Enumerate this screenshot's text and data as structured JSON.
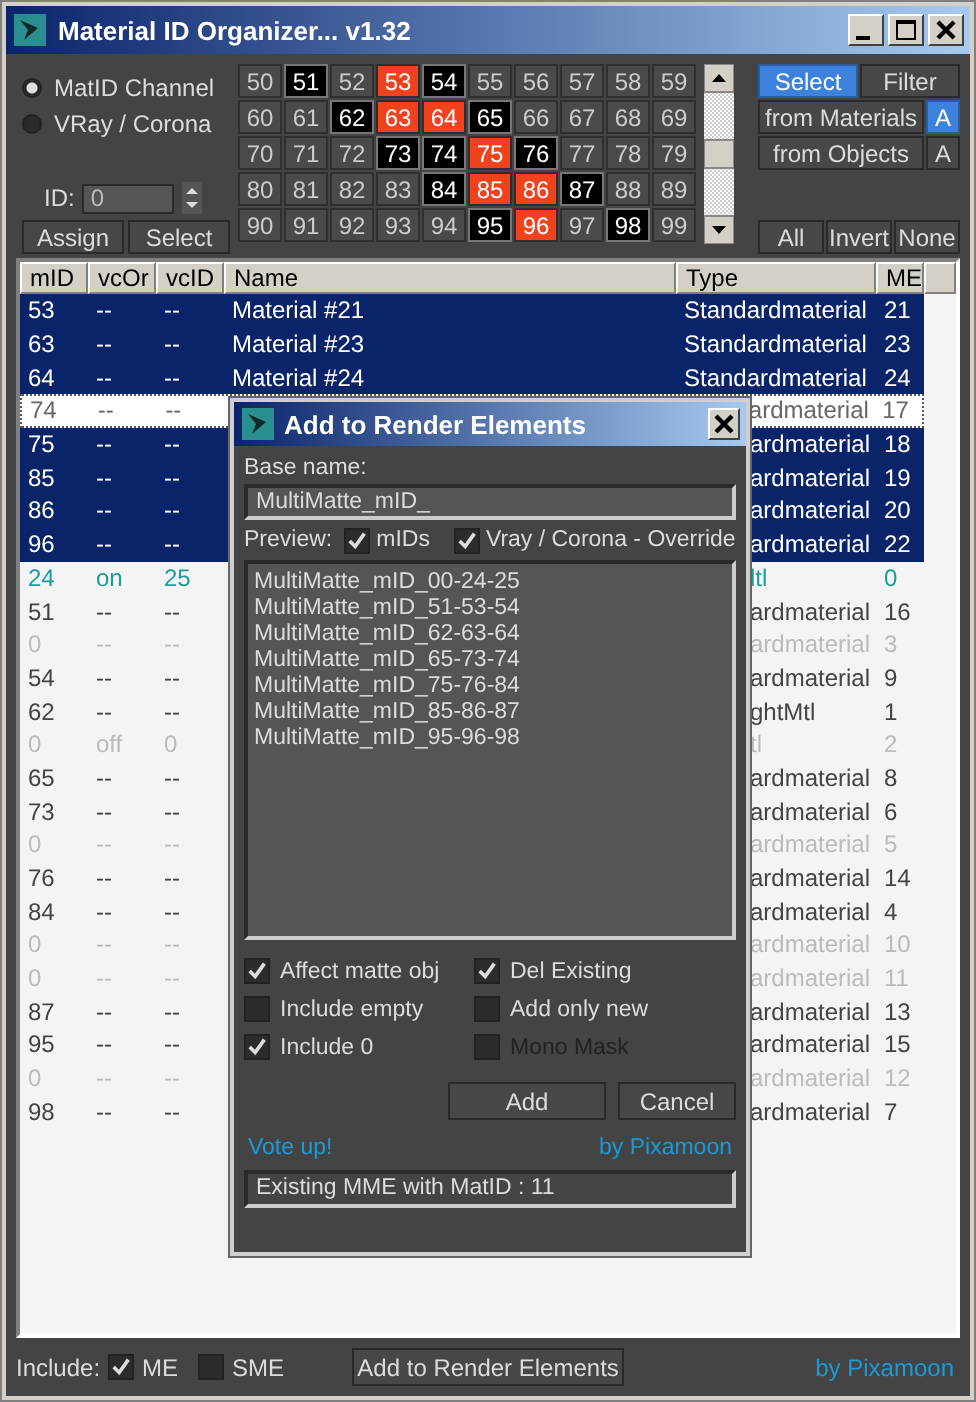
{
  "window": {
    "title": "Material ID Organizer... v1.32"
  },
  "channel_options": [
    {
      "label": "MatID Channel",
      "selected": true
    },
    {
      "label": "VRay / Corona",
      "selected": false
    }
  ],
  "id_field": {
    "label": "ID:",
    "value": "0"
  },
  "id_buttons": [
    "Assign",
    "Select"
  ],
  "id_grid": [
    {
      "label": "50",
      "used": false,
      "selected": false
    },
    {
      "label": "51",
      "used": true,
      "selected": false
    },
    {
      "label": "52",
      "used": false,
      "selected": false
    },
    {
      "label": "53",
      "used": false,
      "selected": true
    },
    {
      "label": "54",
      "used": true,
      "selected": false
    },
    {
      "label": "55",
      "used": false,
      "selected": false
    },
    {
      "label": "56",
      "used": false,
      "selected": false
    },
    {
      "label": "57",
      "used": false,
      "selected": false
    },
    {
      "label": "58",
      "used": false,
      "selected": false
    },
    {
      "label": "59",
      "used": false,
      "selected": false
    },
    {
      "label": "60",
      "used": false,
      "selected": false
    },
    {
      "label": "61",
      "used": false,
      "selected": false
    },
    {
      "label": "62",
      "used": true,
      "selected": false
    },
    {
      "label": "63",
      "used": false,
      "selected": true
    },
    {
      "label": "64",
      "used": false,
      "selected": true
    },
    {
      "label": "65",
      "used": true,
      "selected": false
    },
    {
      "label": "66",
      "used": false,
      "selected": false
    },
    {
      "label": "67",
      "used": false,
      "selected": false
    },
    {
      "label": "68",
      "used": false,
      "selected": false
    },
    {
      "label": "69",
      "used": false,
      "selected": false
    },
    {
      "label": "70",
      "used": false,
      "selected": false
    },
    {
      "label": "71",
      "used": false,
      "selected": false
    },
    {
      "label": "72",
      "used": false,
      "selected": false
    },
    {
      "label": "73",
      "used": true,
      "selected": false
    },
    {
      "label": "74",
      "used": true,
      "selected": false
    },
    {
      "label": "75",
      "used": false,
      "selected": true
    },
    {
      "label": "76",
      "used": true,
      "selected": false
    },
    {
      "label": "77",
      "used": false,
      "selected": false
    },
    {
      "label": "78",
      "used": false,
      "selected": false
    },
    {
      "label": "79",
      "used": false,
      "selected": false
    },
    {
      "label": "80",
      "used": false,
      "selected": false
    },
    {
      "label": "81",
      "used": false,
      "selected": false
    },
    {
      "label": "82",
      "used": false,
      "selected": false
    },
    {
      "label": "83",
      "used": false,
      "selected": false
    },
    {
      "label": "84",
      "used": true,
      "selected": false
    },
    {
      "label": "85",
      "used": false,
      "selected": true
    },
    {
      "label": "86",
      "used": false,
      "selected": true
    },
    {
      "label": "87",
      "used": true,
      "selected": false
    },
    {
      "label": "88",
      "used": false,
      "selected": false
    },
    {
      "label": "89",
      "used": false,
      "selected": false
    },
    {
      "label": "90",
      "used": false,
      "selected": false
    },
    {
      "label": "91",
      "used": false,
      "selected": false
    },
    {
      "label": "92",
      "used": false,
      "selected": false
    },
    {
      "label": "93",
      "used": false,
      "selected": false
    },
    {
      "label": "94",
      "used": false,
      "selected": false
    },
    {
      "label": "95",
      "used": true,
      "selected": false
    },
    {
      "label": "96",
      "used": false,
      "selected": true
    },
    {
      "label": "97",
      "used": false,
      "selected": false
    },
    {
      "label": "98",
      "used": true,
      "selected": false
    },
    {
      "label": "99",
      "used": false,
      "selected": false
    }
  ],
  "mode_tabs": [
    {
      "label": "Select",
      "selected": true
    },
    {
      "label": "Filter",
      "selected": false
    }
  ],
  "source_buttons": [
    {
      "label": "from Materials",
      "toggle": "A",
      "toggle_on": true
    },
    {
      "label": "from Objects",
      "toggle": "A",
      "toggle_on": false
    }
  ],
  "selection_buttons": [
    "All",
    "Invert",
    "None"
  ],
  "table": {
    "columns": [
      "mID",
      "vcOr",
      "vcID",
      "Name",
      "Type",
      "ME"
    ],
    "rows": [
      {
        "mID": "53",
        "vcOr": "--",
        "vcID": "--",
        "name": "Material #21",
        "type": "Standardmaterial",
        "me": "21",
        "kind": "material",
        "selected": true,
        "focused": false,
        "covered": false
      },
      {
        "mID": "63",
        "vcOr": "--",
        "vcID": "--",
        "name": "Material #23",
        "type": "Standardmaterial",
        "me": "23",
        "kind": "material",
        "selected": true,
        "focused": false,
        "covered": false
      },
      {
        "mID": "64",
        "vcOr": "--",
        "vcID": "--",
        "name": "Material #24",
        "type": "Standardmaterial",
        "me": "24",
        "kind": "material",
        "selected": true,
        "focused": false,
        "covered": false
      },
      {
        "mID": "74",
        "vcOr": "--",
        "vcID": "--",
        "type": "ardmaterial",
        "me": "17",
        "kind": "material",
        "selected": false,
        "focused": true,
        "covered": true
      },
      {
        "mID": "75",
        "vcOr": "--",
        "vcID": "--",
        "type": "ardmaterial",
        "me": "18",
        "kind": "material",
        "selected": true,
        "focused": false,
        "covered": true
      },
      {
        "mID": "85",
        "vcOr": "--",
        "vcID": "--",
        "type": "ardmaterial",
        "me": "19",
        "kind": "material",
        "selected": true,
        "focused": false,
        "covered": true
      },
      {
        "mID": "86",
        "vcOr": "--",
        "vcID": "--",
        "type": "ardmaterial",
        "me": "20",
        "kind": "material",
        "selected": true,
        "focused": false,
        "covered": true
      },
      {
        "mID": "96",
        "vcOr": "--",
        "vcID": "--",
        "type": "ardmaterial",
        "me": "22",
        "kind": "material",
        "selected": true,
        "focused": false,
        "covered": true
      },
      {
        "mID": "24",
        "vcOr": "on",
        "vcID": "25",
        "type": "ltl",
        "me": "0",
        "kind": "override",
        "selected": false,
        "focused": false,
        "covered": true
      },
      {
        "mID": "51",
        "vcOr": "--",
        "vcID": "--",
        "type": "ardmaterial",
        "me": "16",
        "kind": "material",
        "selected": false,
        "focused": false,
        "covered": true
      },
      {
        "mID": "0",
        "vcOr": "--",
        "vcID": "--",
        "type": "ardmaterial",
        "me": "3",
        "kind": "empty",
        "selected": false,
        "focused": false,
        "covered": true
      },
      {
        "mID": "54",
        "vcOr": "--",
        "vcID": "--",
        "type": "ardmaterial",
        "me": "9",
        "kind": "material",
        "selected": false,
        "focused": false,
        "covered": true
      },
      {
        "mID": "62",
        "vcOr": "--",
        "vcID": "--",
        "type": "ghtMtl",
        "me": "1",
        "kind": "material",
        "selected": false,
        "focused": false,
        "covered": true
      },
      {
        "mID": "0",
        "vcOr": "off",
        "vcID": "0",
        "type": "tl",
        "me": "2",
        "kind": "empty",
        "selected": false,
        "focused": false,
        "covered": true
      },
      {
        "mID": "65",
        "vcOr": "--",
        "vcID": "--",
        "type": "ardmaterial",
        "me": "8",
        "kind": "material",
        "selected": false,
        "focused": false,
        "covered": true
      },
      {
        "mID": "73",
        "vcOr": "--",
        "vcID": "--",
        "type": "ardmaterial",
        "me": "6",
        "kind": "material",
        "selected": false,
        "focused": false,
        "covered": true
      },
      {
        "mID": "0",
        "vcOr": "--",
        "vcID": "--",
        "type": "ardmaterial",
        "me": "5",
        "kind": "empty",
        "selected": false,
        "focused": false,
        "covered": true
      },
      {
        "mID": "76",
        "vcOr": "--",
        "vcID": "--",
        "type": "ardmaterial",
        "me": "14",
        "kind": "material",
        "selected": false,
        "focused": false,
        "covered": true
      },
      {
        "mID": "84",
        "vcOr": "--",
        "vcID": "--",
        "type": "ardmaterial",
        "me": "4",
        "kind": "material",
        "selected": false,
        "focused": false,
        "covered": true
      },
      {
        "mID": "0",
        "vcOr": "--",
        "vcID": "--",
        "type": "ardmaterial",
        "me": "10",
        "kind": "empty",
        "selected": false,
        "focused": false,
        "covered": true
      },
      {
        "mID": "0",
        "vcOr": "--",
        "vcID": "--",
        "type": "ardmaterial",
        "me": "11",
        "kind": "empty",
        "selected": false,
        "focused": false,
        "covered": true
      },
      {
        "mID": "87",
        "vcOr": "--",
        "vcID": "--",
        "type": "ardmaterial",
        "me": "13",
        "kind": "material",
        "selected": false,
        "focused": false,
        "covered": true
      },
      {
        "mID": "95",
        "vcOr": "--",
        "vcID": "--",
        "type": "ardmaterial",
        "me": "15",
        "kind": "material",
        "selected": false,
        "focused": false,
        "covered": true
      },
      {
        "mID": "0",
        "vcOr": "--",
        "vcID": "--",
        "type": "ardmaterial",
        "me": "12",
        "kind": "empty",
        "selected": false,
        "focused": false,
        "covered": true
      },
      {
        "mID": "98",
        "vcOr": "--",
        "vcID": "--",
        "type": "ardmaterial",
        "me": "7",
        "kind": "material",
        "selected": false,
        "focused": false,
        "covered": true
      }
    ]
  },
  "footer": {
    "include_label": "Include:",
    "options": [
      {
        "label": "ME",
        "checked": true
      },
      {
        "label": "SME",
        "checked": false
      }
    ],
    "button": "Add to Render Elements",
    "credit": "by Pixamoon"
  },
  "dialog": {
    "title": "Add to Render Elements",
    "base_name_label": "Base name:",
    "base_name": "MultiMatte_mID_",
    "preview_label": "Preview:",
    "preview_options": [
      {
        "label": "mIDs",
        "checked": true
      },
      {
        "label": "Vray / Corona - Override",
        "checked": true
      }
    ],
    "preview_items": [
      "MultiMatte_mID_00-24-25",
      "MultiMatte_mID_51-53-54",
      "MultiMatte_mID_62-63-64",
      "MultiMatte_mID_65-73-74",
      "MultiMatte_mID_75-76-84",
      "MultiMatte_mID_85-86-87",
      "MultiMatte_mID_95-96-98"
    ],
    "options": [
      {
        "label": "Affect matte obj",
        "checked": true,
        "disabled": false
      },
      {
        "label": "Del Existing",
        "checked": true,
        "disabled": false
      },
      {
        "label": "Include empty",
        "checked": false,
        "disabled": false
      },
      {
        "label": "Add only new",
        "checked": false,
        "disabled": false
      },
      {
        "label": "Include 0",
        "checked": true,
        "disabled": false
      },
      {
        "label": "Mono Mask",
        "checked": false,
        "disabled": true
      }
    ],
    "buttons": [
      "Add",
      "Cancel"
    ],
    "vote_link": "Vote up!",
    "credit": "by Pixamoon",
    "status": "Existing MME with MatID : 11"
  }
}
